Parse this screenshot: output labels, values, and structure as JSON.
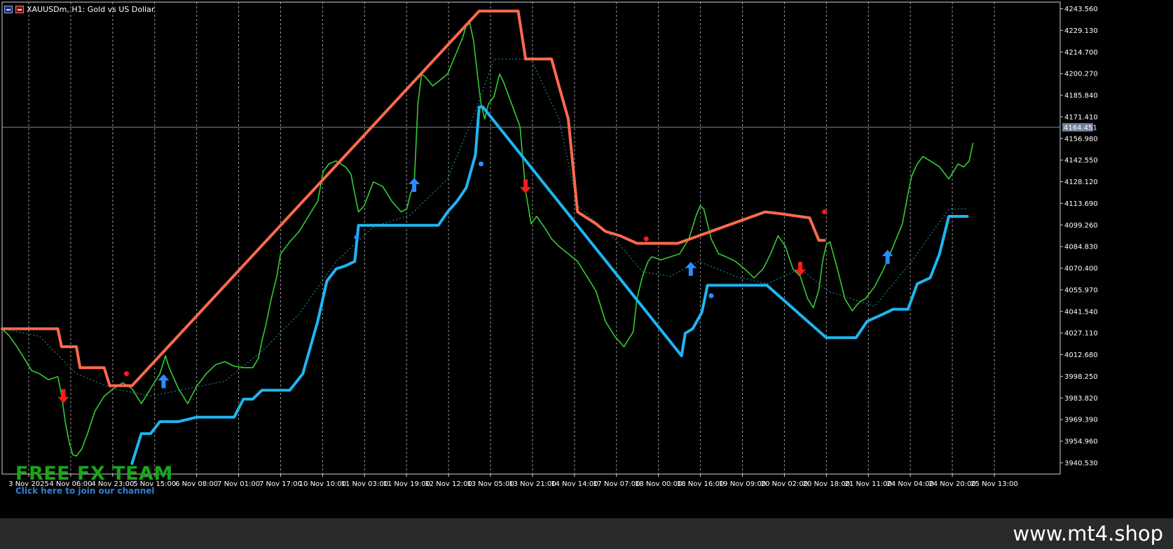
{
  "header": {
    "symbol_title": "XAUUSDm, H1:  Gold vs US Dollar"
  },
  "brand": {
    "title": "FREE FX TEAM",
    "link": "Click here to join our channel"
  },
  "footer": {
    "site": "www.mt4.shop"
  },
  "colors": {
    "background": "#000000",
    "grid": "#d8d8d8",
    "price": "#33cc33",
    "upper_band": "#ff6a4d",
    "lower_band": "#1fb5f0",
    "mid_line": "#1fa0a0",
    "buy_arrow": "#2a8cff",
    "sell_arrow": "#ff1a1a",
    "current_price_line": "#7a8ea8",
    "footer_bg": "#2a2a2a"
  },
  "chart_data": {
    "type": "line",
    "title": "XAUUSDm, H1:  Gold vs US Dollar",
    "current_price": "4164.451",
    "ylim": [
      3933.0,
      4248.0
    ],
    "y_ticks": [
      "4243.560",
      "4229.130",
      "4214.700",
      "4200.270",
      "4185.840",
      "4171.410",
      "4156.980",
      "4142.550",
      "4128.120",
      "4113.690",
      "4099.260",
      "4084.830",
      "4070.400",
      "4055.970",
      "4041.540",
      "4027.110",
      "4012.680",
      "3998.250",
      "3983.820",
      "3969.390",
      "3954.960",
      "3940.530"
    ],
    "x_labels": [
      "3 Nov 2025",
      "4 Nov 06:00",
      "4 Nov 23:00",
      "5 Nov 15:00",
      "6 Nov 08:00",
      "7 Nov 01:00",
      "7 Nov 17:00",
      "10 Nov 10:00",
      "11 Nov 03:00",
      "11 Nov 19:00",
      "12 Nov 12:00",
      "13 Nov 05:00",
      "13 Nov 21:00",
      "14 Nov 14:00",
      "17 Nov 07:00",
      "18 Nov 00:00",
      "18 Nov 16:00",
      "19 Nov 09:00",
      "20 Nov 02:00",
      "20 Nov 18:00",
      "21 Nov 11:00",
      "24 Nov 04:00",
      "24 Nov 20:00",
      "25 Nov 13:00"
    ],
    "x_range": [
      0,
      570
    ],
    "price": [
      [
        0,
        4030
      ],
      [
        4,
        4025
      ],
      [
        8,
        4018
      ],
      [
        12,
        4010
      ],
      [
        16,
        4002
      ],
      [
        20,
        4000
      ],
      [
        25,
        3996
      ],
      [
        30,
        3998
      ],
      [
        32,
        3986
      ],
      [
        34,
        3968
      ],
      [
        36,
        3955
      ],
      [
        38,
        3946
      ],
      [
        40,
        3945
      ],
      [
        43,
        3950
      ],
      [
        46,
        3960
      ],
      [
        50,
        3975
      ],
      [
        55,
        3985
      ],
      [
        60,
        3990
      ],
      [
        65,
        3994
      ],
      [
        70,
        3990
      ],
      [
        75,
        3980
      ],
      [
        80,
        3990
      ],
      [
        85,
        4000
      ],
      [
        88,
        4012
      ],
      [
        90,
        4004
      ],
      [
        95,
        3990
      ],
      [
        100,
        3980
      ],
      [
        105,
        3992
      ],
      [
        110,
        4000
      ],
      [
        115,
        4006
      ],
      [
        120,
        4008
      ],
      [
        125,
        4005
      ],
      [
        130,
        4004
      ],
      [
        135,
        4004
      ],
      [
        138,
        4010
      ],
      [
        140,
        4022
      ],
      [
        142,
        4032
      ],
      [
        145,
        4050
      ],
      [
        148,
        4065
      ],
      [
        150,
        4080
      ],
      [
        155,
        4088
      ],
      [
        160,
        4095
      ],
      [
        165,
        4105
      ],
      [
        170,
        4115
      ],
      [
        173,
        4135
      ],
      [
        176,
        4140
      ],
      [
        180,
        4142
      ],
      [
        185,
        4138
      ],
      [
        188,
        4133
      ],
      [
        190,
        4120
      ],
      [
        192,
        4108
      ],
      [
        195,
        4112
      ],
      [
        200,
        4128
      ],
      [
        205,
        4125
      ],
      [
        210,
        4115
      ],
      [
        215,
        4108
      ],
      [
        218,
        4110
      ],
      [
        220,
        4120
      ],
      [
        222,
        4126
      ],
      [
        224,
        4180
      ],
      [
        226,
        4200
      ],
      [
        228,
        4198
      ],
      [
        232,
        4192
      ],
      [
        236,
        4196
      ],
      [
        240,
        4200
      ],
      [
        244,
        4212
      ],
      [
        248,
        4224
      ],
      [
        250,
        4232
      ],
      [
        252,
        4234
      ],
      [
        254,
        4222
      ],
      [
        256,
        4200
      ],
      [
        258,
        4180
      ],
      [
        260,
        4170
      ],
      [
        262,
        4180
      ],
      [
        265,
        4185
      ],
      [
        268,
        4200
      ],
      [
        270,
        4195
      ],
      [
        273,
        4185
      ],
      [
        276,
        4175
      ],
      [
        279,
        4165
      ],
      [
        282,
        4122
      ],
      [
        285,
        4100
      ],
      [
        288,
        4105
      ],
      [
        292,
        4098
      ],
      [
        296,
        4090
      ],
      [
        300,
        4085
      ],
      [
        305,
        4080
      ],
      [
        310,
        4075
      ],
      [
        315,
        4065
      ],
      [
        320,
        4055
      ],
      [
        325,
        4035
      ],
      [
        330,
        4025
      ],
      [
        335,
        4018
      ],
      [
        340,
        4028
      ],
      [
        342,
        4050
      ],
      [
        345,
        4065
      ],
      [
        348,
        4075
      ],
      [
        350,
        4078
      ],
      [
        355,
        4076
      ],
      [
        360,
        4078
      ],
      [
        365,
        4080
      ],
      [
        370,
        4090
      ],
      [
        374,
        4106
      ],
      [
        376,
        4112
      ],
      [
        378,
        4110
      ],
      [
        382,
        4090
      ],
      [
        386,
        4080
      ],
      [
        390,
        4078
      ],
      [
        395,
        4075
      ],
      [
        400,
        4070
      ],
      [
        405,
        4064
      ],
      [
        410,
        4070
      ],
      [
        414,
        4080
      ],
      [
        418,
        4092
      ],
      [
        422,
        4085
      ],
      [
        426,
        4070
      ],
      [
        430,
        4065
      ],
      [
        434,
        4050
      ],
      [
        437,
        4044
      ],
      [
        440,
        4056
      ],
      [
        442,
        4075
      ],
      [
        444,
        4086
      ],
      [
        446,
        4088
      ],
      [
        450,
        4070
      ],
      [
        454,
        4050
      ],
      [
        458,
        4042
      ],
      [
        462,
        4048
      ],
      [
        465,
        4050
      ],
      [
        470,
        4058
      ],
      [
        475,
        4070
      ],
      [
        480,
        4085
      ],
      [
        485,
        4100
      ],
      [
        488,
        4120
      ],
      [
        490,
        4132
      ],
      [
        493,
        4140
      ],
      [
        496,
        4145
      ],
      [
        500,
        4142
      ],
      [
        505,
        4138
      ],
      [
        510,
        4130
      ],
      [
        515,
        4140
      ],
      [
        518,
        4138
      ],
      [
        521,
        4142
      ],
      [
        523,
        4154
      ]
    ],
    "upper_band": [
      [
        0,
        4030
      ],
      [
        30,
        4030
      ],
      [
        32,
        4018
      ],
      [
        40,
        4018
      ],
      [
        42,
        4004
      ],
      [
        55,
        4004
      ],
      [
        58,
        3992
      ],
      [
        70,
        3992
      ],
      [
        257,
        4242
      ],
      [
        278,
        4242
      ],
      [
        282,
        4210
      ],
      [
        296,
        4210
      ],
      [
        300,
        4192
      ],
      [
        305,
        4170
      ],
      [
        310,
        4108
      ],
      [
        320,
        4100
      ],
      [
        325,
        4095
      ],
      [
        333,
        4092
      ],
      [
        342,
        4087
      ],
      [
        364,
        4087
      ],
      [
        411,
        4108
      ],
      [
        418,
        4107
      ],
      [
        435,
        4104
      ],
      [
        440,
        4089
      ],
      [
        443,
        4089
      ]
    ],
    "lower_band": [
      [
        70,
        3940
      ],
      [
        75,
        3960
      ],
      [
        80,
        3960
      ],
      [
        85,
        3968
      ],
      [
        95,
        3968
      ],
      [
        105,
        3971
      ],
      [
        125,
        3971
      ],
      [
        130,
        3983
      ],
      [
        135,
        3983
      ],
      [
        140,
        3989
      ],
      [
        155,
        3989
      ],
      [
        162,
        4000
      ],
      [
        170,
        4035
      ],
      [
        175,
        4062
      ],
      [
        180,
        4070
      ],
      [
        185,
        4072
      ],
      [
        190,
        4075
      ],
      [
        192,
        4099
      ],
      [
        225,
        4099
      ],
      [
        235,
        4099
      ],
      [
        240,
        4108
      ],
      [
        245,
        4115
      ],
      [
        250,
        4124
      ],
      [
        255,
        4146
      ],
      [
        257,
        4178
      ],
      [
        259,
        4178
      ],
      [
        366,
        4012
      ],
      [
        368,
        4027
      ],
      [
        372,
        4030
      ],
      [
        377,
        4041
      ],
      [
        380,
        4059
      ],
      [
        395,
        4059
      ],
      [
        412,
        4059
      ],
      [
        444,
        4024
      ],
      [
        460,
        4024
      ],
      [
        466,
        4035
      ],
      [
        475,
        4040
      ],
      [
        480,
        4043
      ],
      [
        488,
        4043
      ],
      [
        493,
        4060
      ],
      [
        500,
        4064
      ],
      [
        505,
        4080
      ],
      [
        510,
        4105
      ],
      [
        520,
        4105
      ]
    ],
    "mid_line": [
      [
        0,
        4030
      ],
      [
        20,
        4025
      ],
      [
        40,
        4000
      ],
      [
        60,
        3990
      ],
      [
        80,
        3985
      ],
      [
        100,
        3990
      ],
      [
        120,
        3995
      ],
      [
        140,
        4015
      ],
      [
        160,
        4040
      ],
      [
        180,
        4075
      ],
      [
        200,
        4098
      ],
      [
        220,
        4106
      ],
      [
        240,
        4130
      ],
      [
        255,
        4175
      ],
      [
        265,
        4210
      ],
      [
        285,
        4210
      ],
      [
        300,
        4170
      ],
      [
        310,
        4112
      ],
      [
        330,
        4090
      ],
      [
        345,
        4068
      ],
      [
        360,
        4065
      ],
      [
        375,
        4075
      ],
      [
        395,
        4065
      ],
      [
        412,
        4060
      ],
      [
        430,
        4070
      ],
      [
        445,
        4055
      ],
      [
        470,
        4045
      ],
      [
        490,
        4075
      ],
      [
        510,
        4110
      ],
      [
        520,
        4110
      ]
    ],
    "buy_arrows": [
      [
        87,
        3995
      ],
      [
        222,
        4126
      ],
      [
        371,
        4070
      ],
      [
        477,
        4078
      ]
    ],
    "sell_arrows": [
      [
        33,
        3985
      ],
      [
        282,
        4125
      ],
      [
        430,
        4070
      ]
    ],
    "buy_dots": [
      [
        191,
        4091
      ],
      [
        258,
        4140
      ],
      [
        382,
        4052
      ]
    ],
    "sell_dots": [
      [
        67,
        4000
      ],
      [
        347,
        4090
      ],
      [
        443,
        4108
      ]
    ],
    "legend": "none",
    "grid": "vertical-dashed"
  }
}
